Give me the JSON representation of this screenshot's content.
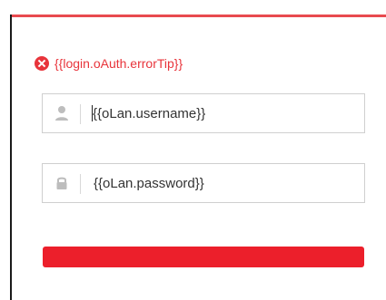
{
  "login": {
    "error_tip": "{{login.oAuth.errorTip}}",
    "username_value": "{{oLan.username}}",
    "password_value": "{{oLan.password}}"
  },
  "icons": {
    "error": "error-x-icon",
    "user": "user-icon",
    "lock": "lock-icon"
  },
  "colors": {
    "accent": "#ec1f2b",
    "error": "#e8343b",
    "border": "#cfcfcf",
    "icon": "#bdbdbd"
  }
}
